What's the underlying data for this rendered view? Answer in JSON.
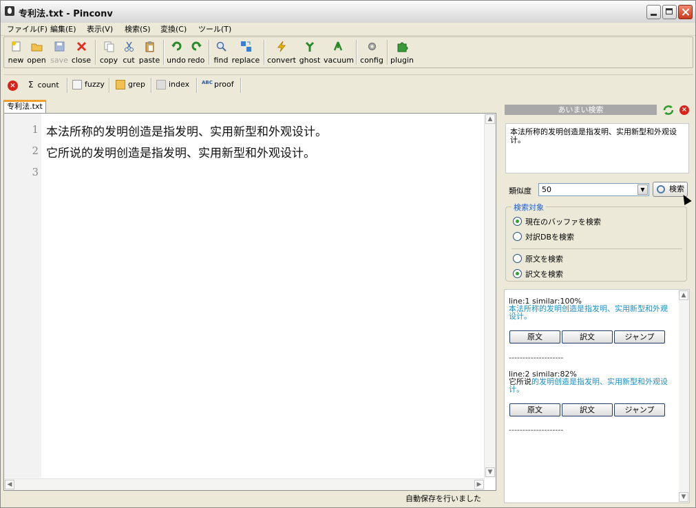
{
  "window": {
    "title": "专利法.txt - Pinconv"
  },
  "menu": [
    "ファイル(F)",
    "編集(E)",
    "表示(V)",
    "検索(S)",
    "変換(C)",
    "ツール(T)"
  ],
  "toolbar": {
    "new": "new",
    "open": "open",
    "save": "save",
    "close": "close",
    "copy": "copy",
    "cut": "cut",
    "paste": "paste",
    "undo": "undo",
    "redo": "redo",
    "find": "find",
    "replace": "replace",
    "convert": "convert",
    "ghost": "ghost",
    "vacuum": "vacuum",
    "config": "config",
    "plugin": "plugin"
  },
  "toolbar2": {
    "count": "count",
    "fuzzy": "fuzzy",
    "grep": "grep",
    "index": "index",
    "proof": "proof",
    "sigma": "Σ"
  },
  "tab": {
    "label": "专利法.txt"
  },
  "editor": {
    "lines": [
      {
        "no": "1",
        "text": "本法所称的发明创造是指发明、实用新型和外观设计。"
      },
      {
        "no": "2",
        "text": "它所说的发明创造是指发明、实用新型和外观设计。"
      },
      {
        "no": "3",
        "text": ""
      }
    ]
  },
  "status": {
    "text": "自動保存を行いました"
  },
  "fuzzy_panel": {
    "header": "あいまい検索",
    "query": "本法所称的发明创造是指发明、实用新型和外观设计。",
    "similarity_label": "類似度",
    "similarity_value": "50",
    "search_button": "検索",
    "target_group_title": "検索対象",
    "targets": [
      {
        "label": "現在のバッファを検索",
        "checked": true
      },
      {
        "label": "対訳DBを検索",
        "checked": false
      },
      {
        "label": "原文を検索",
        "checked": false
      },
      {
        "label": "訳文を検索",
        "checked": true
      }
    ],
    "results": [
      {
        "header": "line:1 similar:100%",
        "plain": "",
        "hit": "本法所称的发明创造是指发明、实用新型和外观设计。",
        "buttons": [
          "原文",
          "訳文",
          "ジャンプ"
        ]
      },
      {
        "header": "line:2 similar:82%",
        "plain": "它所说",
        "hit": "的发明创造是指发明、实用新型和外观设计。",
        "buttons": [
          "原文",
          "訳文",
          "ジャンプ"
        ]
      }
    ],
    "separator": "--------------------"
  }
}
